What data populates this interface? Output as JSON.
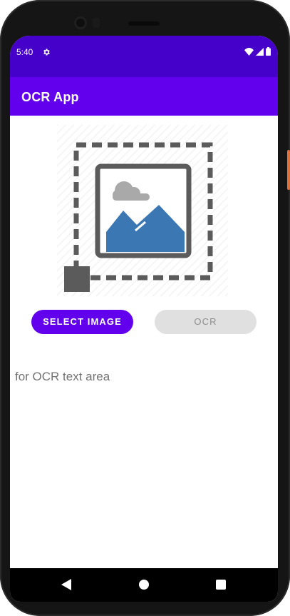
{
  "status": {
    "time": "5:40",
    "settings_icon": "gear-icon",
    "icons": [
      "wifi-icon",
      "cell-signal-icon",
      "battery-icon"
    ]
  },
  "appbar": {
    "title": "OCR App"
  },
  "image_placeholder": {
    "icon": "image-select-placeholder-icon"
  },
  "buttons": {
    "select_label": "SELECT IMAGE",
    "ocr_label": "OCR"
  },
  "ocr_text": "for OCR text area",
  "navbar": {
    "back": "back-icon",
    "home": "home-icon",
    "recents": "recents-icon"
  },
  "colors": {
    "status_bar": "#4500c9",
    "app_bar": "#6200ee",
    "primary_button": "#6200ee",
    "disabled_button": "#e0e0e0"
  }
}
